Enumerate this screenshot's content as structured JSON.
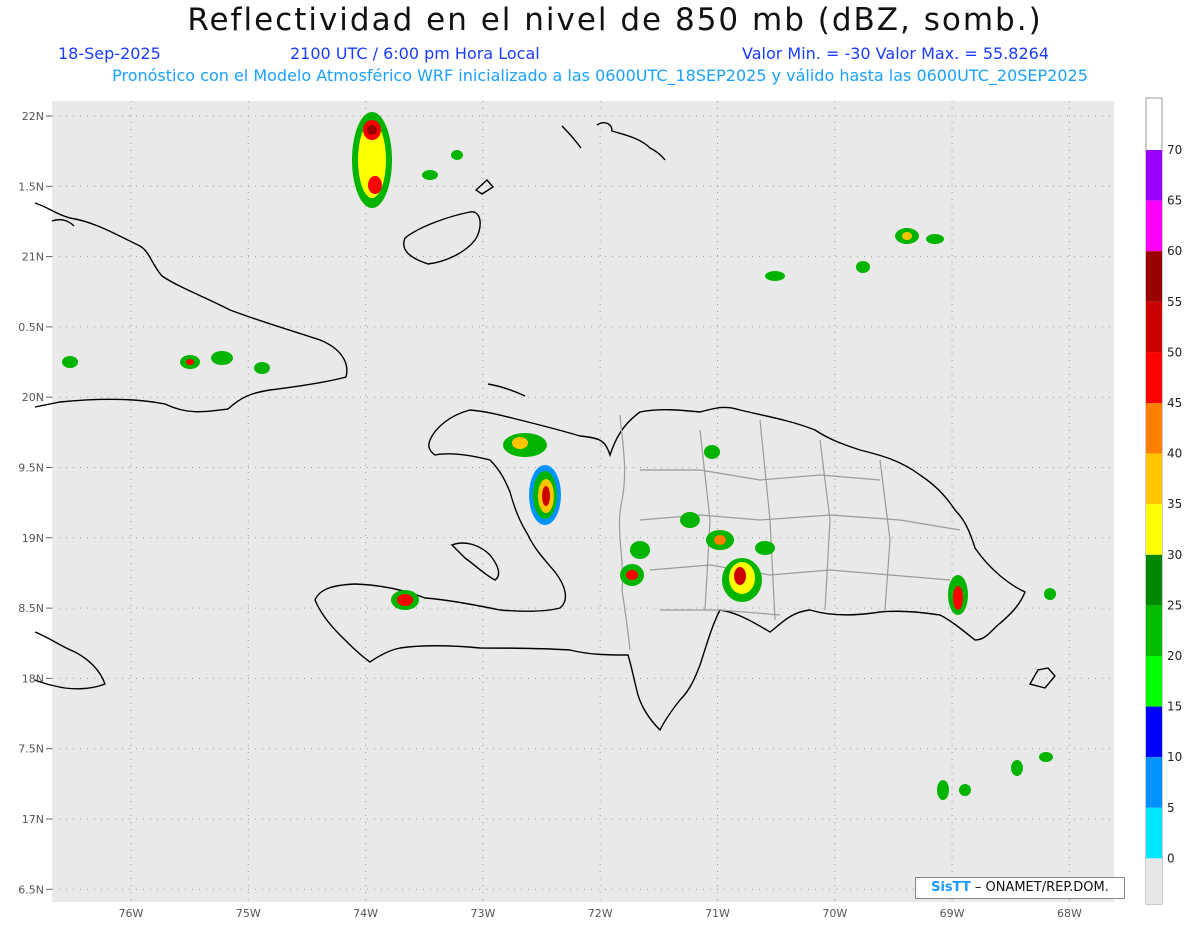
{
  "header": {
    "title": "Reflectividad en el nivel de 850 mb (dBZ, somb.)",
    "date": "18-Sep-2025",
    "time": "2100 UTC / 6:00 pm Hora Local",
    "min_max": "Valor Min. = -30  Valor Max. = 55.8264",
    "description": "Pronóstico con el Modelo Atmosférico WRF inicializado a las 0600UTC_18SEP2025 y válido hasta las  0600UTC_20SEP2025"
  },
  "axes": {
    "lat_labels": [
      "22N",
      "1.5N",
      "21N",
      "0.5N",
      "20N",
      "9.5N",
      "19N",
      "8.5N",
      "18N",
      "7.5N",
      "17N",
      "6.5N"
    ],
    "lon_labels": [
      "76W",
      "75W",
      "74W",
      "73W",
      "72W",
      "71W",
      "70W",
      "69W",
      "68W"
    ]
  },
  "colorbar": {
    "labels": [
      "70",
      "65",
      "60",
      "55",
      "50",
      "45",
      "40",
      "35",
      "30",
      "25",
      "20",
      "15",
      "10",
      "5",
      "0"
    ],
    "colors": [
      "#9b00ff",
      "#ff00ff",
      "#990000",
      "#cc0000",
      "#ff0000",
      "#ff7f00",
      "#ffc600",
      "#ffff00",
      "#008800",
      "#00bb00",
      "#00ff00",
      "#0000ff",
      "#0093ff",
      "#00e6ff"
    ],
    "below_color": "#e6e6e6"
  },
  "credit": {
    "logo": "SisTT",
    "text": "– ONAMET/REP.DOM."
  },
  "colors": {
    "map_background": "#e9e9e9",
    "coast": "#000000",
    "provinces": "#999999",
    "grid": "#9a9a9a"
  }
}
